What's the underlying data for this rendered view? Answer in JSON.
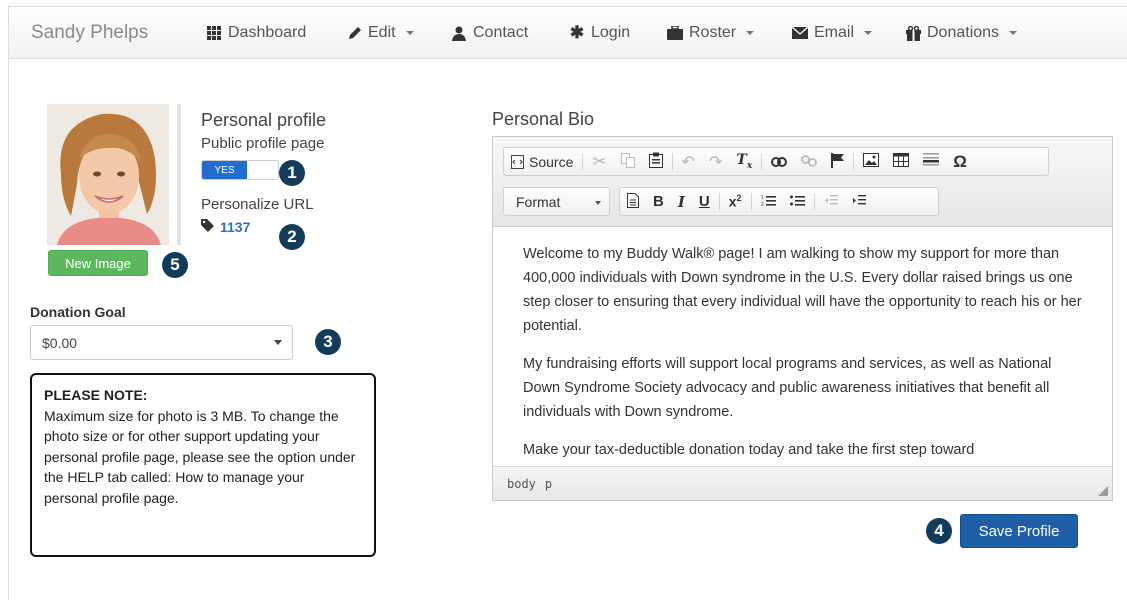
{
  "navbar": {
    "brand": "Sandy Phelps",
    "items": [
      {
        "label": "Dashboard",
        "icon": "grid-icon",
        "dropdown": false
      },
      {
        "label": "Edit",
        "icon": "pencil-icon",
        "dropdown": true
      },
      {
        "label": "Contact",
        "icon": "user-icon",
        "dropdown": false
      },
      {
        "label": "Login",
        "icon": "asterisk-icon",
        "dropdown": false
      },
      {
        "label": "Roster",
        "icon": "briefcase-icon",
        "dropdown": true
      },
      {
        "label": "Email",
        "icon": "envelope-icon",
        "dropdown": true
      },
      {
        "label": "Donations",
        "icon": "gift-icon",
        "dropdown": true
      }
    ]
  },
  "profile": {
    "title": "Personal profile",
    "public_label": "Public profile page",
    "toggle_value": "YES",
    "personalize_label": "Personalize URL",
    "url_value": "1137",
    "new_image_label": "New Image"
  },
  "donation": {
    "label": "Donation Goal",
    "selected": "$0.00"
  },
  "note": {
    "title": "PLEASE NOTE:",
    "body": "Maximum size for photo is 3 MB. To change the photo size or for other support updating your personal profile page, please see the option under the HELP tab called: How to manage your personal profile page."
  },
  "bio": {
    "title": "Personal Bio",
    "toolbar": {
      "source_label": "Source",
      "format_label": "Format"
    },
    "paragraphs": [
      "Welcome to my Buddy Walk® page!  I am walking to show my support for more than 400,000 individuals with Down syndrome in the U.S.  Every dollar raised brings us one step closer to ensuring that every individual will have the opportunity to reach his or her potential.",
      "My fundraising efforts will support local programs and services, as well as National Down Syndrome Society advocacy and public awareness initiatives that benefit all individuals with Down syndrome.",
      "Make your tax-deductible donation today and take the first step toward"
    ],
    "status": [
      "body",
      "p"
    ]
  },
  "save_label": "Save Profile",
  "badges": [
    "1",
    "2",
    "3",
    "4",
    "5"
  ],
  "colors": {
    "primary": "#1f5fa8",
    "success": "#5cb85c",
    "badge": "#133c5a",
    "toggle_on": "#1f6fcf"
  }
}
